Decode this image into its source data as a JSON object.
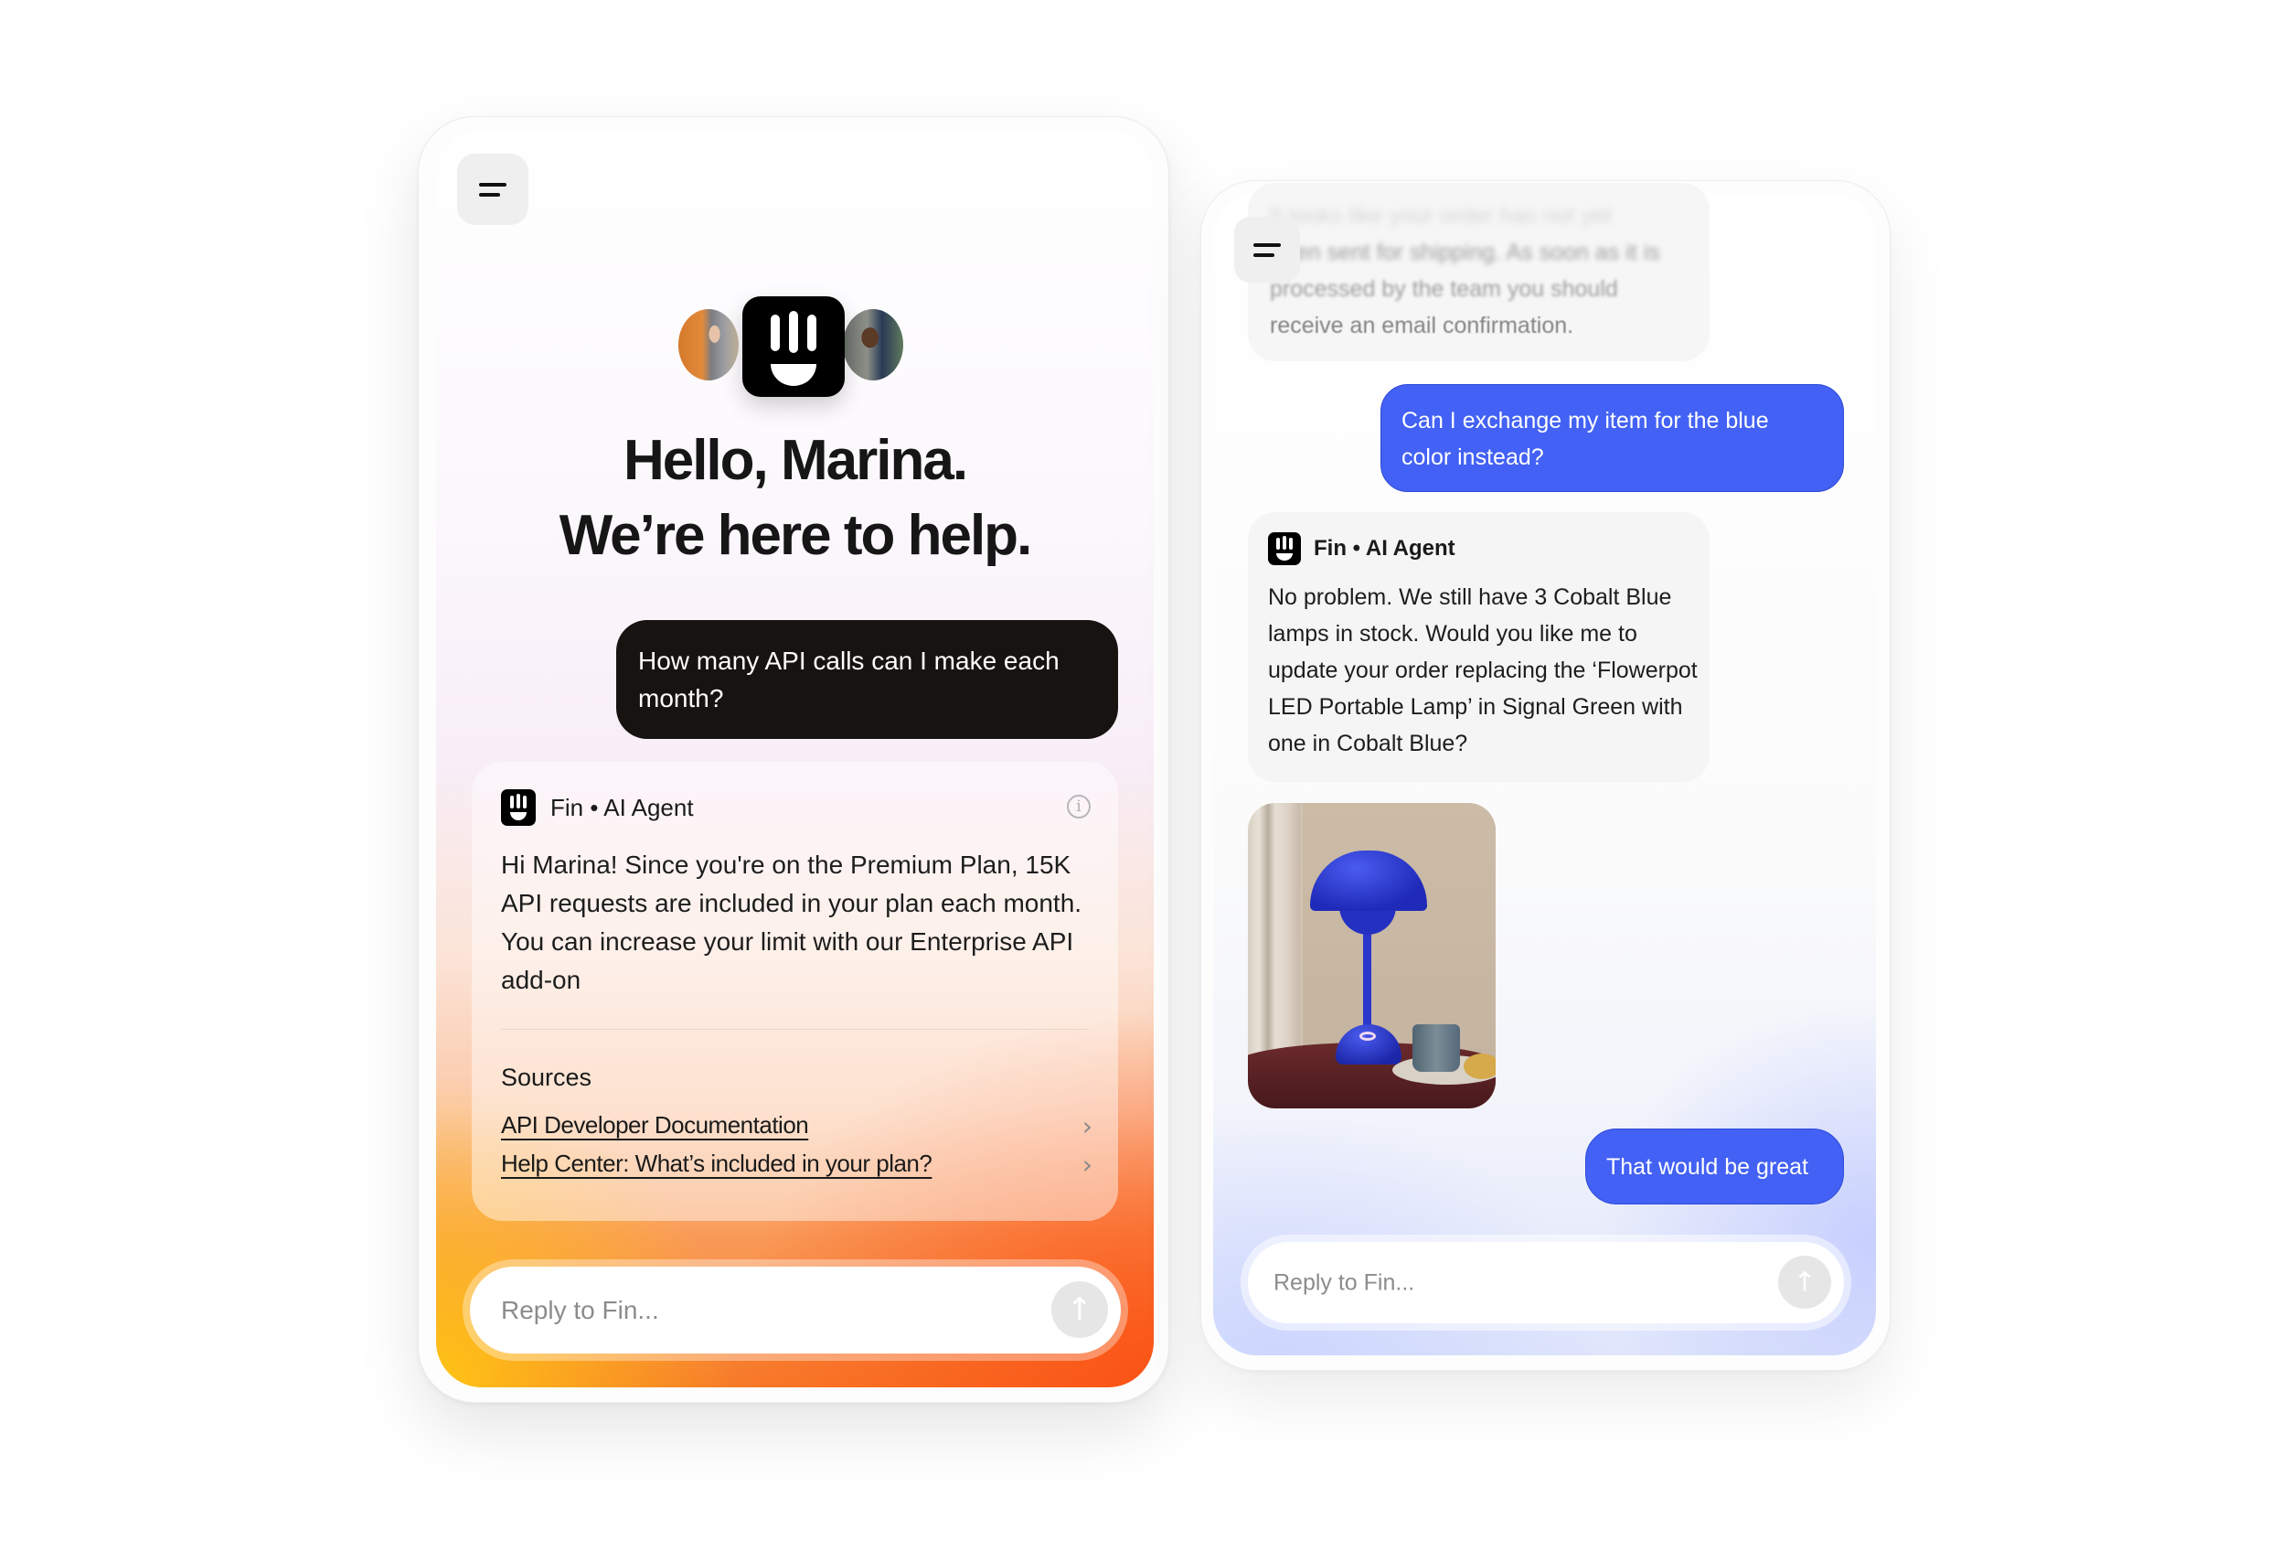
{
  "left_widget": {
    "menu_icon": "menu-icon",
    "avatars": [
      "agent-avatar-woman",
      "fin-logo",
      "agent-avatar-man"
    ],
    "greeting_line1": "Hello, Marina.",
    "greeting_line2": "We’re here to help.",
    "user_message": "How many API calls can I make each month?",
    "agent": {
      "name": "Fin",
      "separator": "•",
      "role": "AI Agent",
      "info_icon_glyph": "i",
      "message": "Hi Marina! Since you're on the Premium Plan, 15K API requests are included in your plan each month. You can increase your limit with our Enterprise API add-on",
      "sources_title": "Sources",
      "sources": [
        {
          "label": "API Developer Documentation",
          "chevron": "›"
        },
        {
          "label": "Help Center: What’s included in your plan?",
          "chevron": "›"
        }
      ]
    },
    "input": {
      "placeholder": "Reply to Fin...",
      "send_glyph": "↑"
    },
    "accent_colors": {
      "user_bubble": "#171311",
      "gradient_orange": "#f77a28",
      "gradient_yellow": "#ffc814"
    }
  },
  "right_widget": {
    "previous_agent_message_lines": [
      "It looks like your order has not yet",
      "been sent for shipping. As soon as it is",
      "processed by the team you should",
      "receive an email confirmation."
    ],
    "user_message_1": "Can I exchange my item for the blue color instead?",
    "agent": {
      "name": "Fin",
      "separator": "•",
      "role": "AI Agent",
      "message": "No problem. We still have 3 Cobalt Blue lamps in stock. Would you like me to  update your order replacing the ‘Flowerpot LED Portable Lamp’ in Signal Green with one in Cobalt Blue?"
    },
    "image_alt": "Cobalt Blue Flowerpot LED Portable Lamp on a table",
    "user_message_2": "That would be great",
    "input": {
      "placeholder": "Reply to Fin...",
      "send_glyph": "↑"
    },
    "accent_colors": {
      "user_bubble": "#4361f4"
    }
  }
}
